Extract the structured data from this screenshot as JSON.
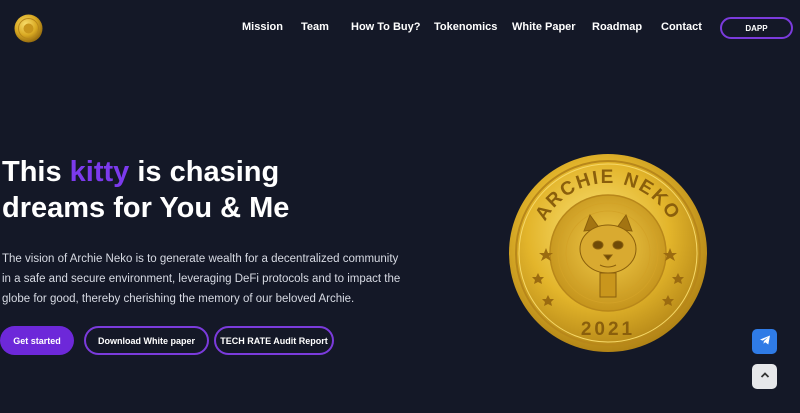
{
  "nav": {
    "items": [
      {
        "label": "Mission"
      },
      {
        "label": "Team"
      },
      {
        "label": "How To Buy?"
      },
      {
        "label": "Tokenomics"
      },
      {
        "label": "White Paper"
      },
      {
        "label": "Roadmap"
      },
      {
        "label": "Contact"
      }
    ],
    "dapp_label": "DAPP"
  },
  "hero": {
    "title_part1": "This ",
    "title_accent": "kitty",
    "title_part2": " is chasing dreams for You & Me",
    "description": "The vision of Archie Neko is to generate wealth for a decentralized community in a safe and secure environment, leveraging DeFi protocols and to impact the globe for good, thereby cherishing the memory of our beloved Archie.",
    "buttons": {
      "get_started": "Get started",
      "download_wp": "Download White paper",
      "audit_report": "TECH RATE Audit Report"
    }
  },
  "coin": {
    "top_text": "ARCHIE NEKO",
    "year": "2021"
  },
  "colors": {
    "background": "#141827",
    "accent": "#7c3aed",
    "button_primary": "#6d28d9",
    "telegram": "#2f7be6",
    "coin_gold": "#e0b52c"
  },
  "icons": {
    "telegram": "telegram-icon",
    "scroll_top": "chevron-up-icon",
    "logo": "coin-logo-icon"
  }
}
